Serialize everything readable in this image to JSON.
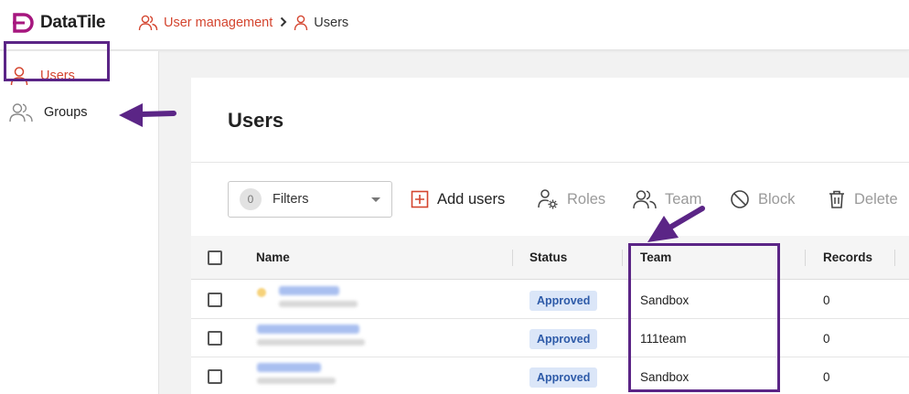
{
  "app": {
    "name": "DataTile",
    "brand_color": "#a6167e"
  },
  "breadcrumb": {
    "parent": "User management",
    "current": "Users"
  },
  "sidebar": {
    "items": [
      {
        "label": "Users",
        "icon": "user-icon",
        "active": true
      },
      {
        "label": "Groups",
        "icon": "users-group-icon",
        "active": false
      }
    ]
  },
  "page": {
    "title": "Users"
  },
  "toolbar": {
    "filters_count": "0",
    "filters_label": "Filters",
    "add_users": "Add users",
    "roles": "Roles",
    "team": "Team",
    "block": "Block",
    "delete": "Delete"
  },
  "table": {
    "columns": [
      "Name",
      "Status",
      "Team",
      "Records"
    ],
    "rows": [
      {
        "status": "Approved",
        "team": "Sandbox",
        "records": "0"
      },
      {
        "status": "Approved",
        "team": "111team",
        "records": "0"
      },
      {
        "status": "Approved",
        "team": "Sandbox",
        "records": "0"
      }
    ]
  },
  "colors": {
    "accent": "#d4452f",
    "annotation": "#5b2586",
    "badge_bg": "#dbe6f8",
    "badge_text": "#2d5aa8"
  }
}
